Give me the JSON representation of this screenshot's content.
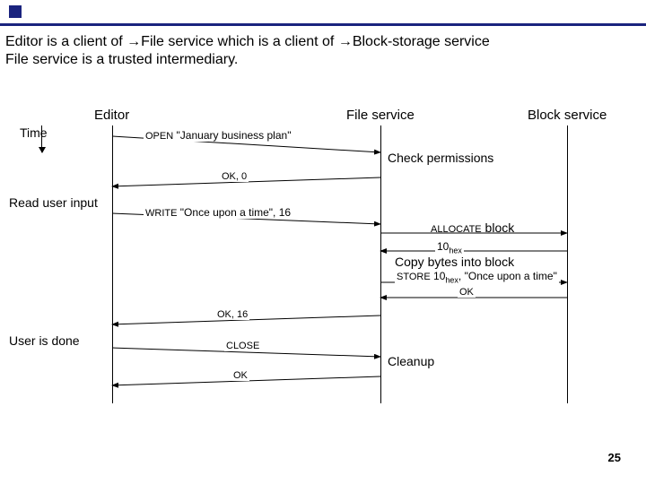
{
  "header": {
    "line1_a": "Editor is a client of ",
    "line1_b": "File service which is a client of ",
    "line1_c": "Block-storage service",
    "line2": "File service is a trusted intermediary."
  },
  "arrow_glyph": "→",
  "lifelines": {
    "editor": "Editor",
    "file": "File service",
    "block": "Block service"
  },
  "time_label": "Time",
  "side": {
    "read_user_input": "Read user input",
    "user_is_done": "User is done",
    "check_permissions": "Check permissions",
    "allocate_block": " block",
    "allocate_prefix": "ALLOCATE",
    "copy_bytes": "Copy bytes into block",
    "cleanup": "Cleanup"
  },
  "messages": {
    "open": "OPEN",
    "open_arg": "\"January business plan\"",
    "ok0": "OK, 0",
    "write": "WRITE",
    "write_arg": "\"Once upon a time\", 16",
    "ten_hex": "10",
    "hex_suffix": "hex",
    "store": "STORE",
    "store_arg": "\"Once upon a time\"",
    "ok": "OK",
    "ok16": "OK, 16",
    "close": "CLOSE"
  },
  "page_number": "25",
  "chart_data": {
    "type": "sequence-diagram",
    "lifelines": [
      "Editor",
      "File service",
      "Block service"
    ],
    "time_axis": "top-to-bottom",
    "events": [
      {
        "from": "Editor",
        "to": "File service",
        "label": "OPEN \"January business plan\""
      },
      {
        "at": "File service",
        "note": "Check permissions"
      },
      {
        "from": "File service",
        "to": "Editor",
        "label": "OK, 0"
      },
      {
        "at": "Editor",
        "note": "Read user input"
      },
      {
        "from": "Editor",
        "to": "File service",
        "label": "WRITE \"Once upon a time\", 16"
      },
      {
        "from": "File service",
        "to": "Block service",
        "label": "ALLOCATE block"
      },
      {
        "from": "Block service",
        "to": "File service",
        "label": "10_hex"
      },
      {
        "at": "File service",
        "note": "Copy bytes into block"
      },
      {
        "from": "File service",
        "to": "Block service",
        "label": "STORE 10_hex, \"Once upon a time\""
      },
      {
        "from": "Block service",
        "to": "File service",
        "label": "OK"
      },
      {
        "from": "File service",
        "to": "Editor",
        "label": "OK, 16"
      },
      {
        "at": "Editor",
        "note": "User is done"
      },
      {
        "from": "Editor",
        "to": "File service",
        "label": "CLOSE"
      },
      {
        "at": "File service",
        "note": "Cleanup"
      },
      {
        "from": "File service",
        "to": "Editor",
        "label": "OK"
      }
    ]
  }
}
